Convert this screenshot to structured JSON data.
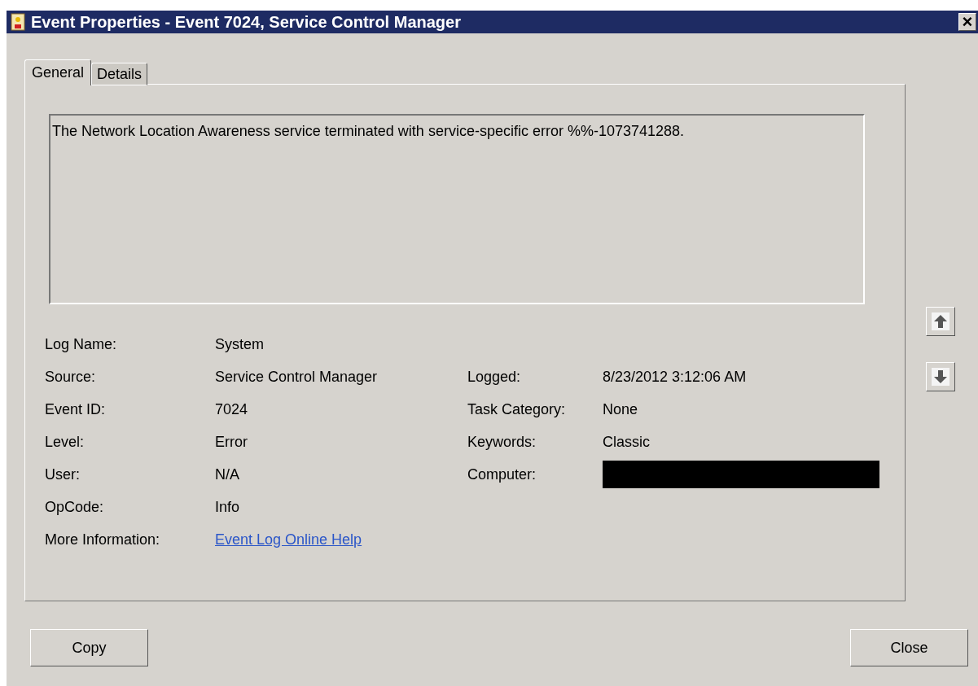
{
  "window": {
    "title": "Event Properties - Event 7024, Service Control Manager",
    "close_glyph": "×"
  },
  "tabs": [
    {
      "label": "General",
      "selected": true
    },
    {
      "label": "Details",
      "selected": false
    }
  ],
  "message": "The Network Location Awareness service terminated with service-specific error %%-1073741288.",
  "rows": [
    {
      "label": "Log Name:",
      "value": "System"
    },
    {
      "label": "Source:",
      "value": "Service Control Manager",
      "right": {
        "label": "Logged:",
        "value": "8/23/2012 3:12:06 AM",
        "kind": "text"
      }
    },
    {
      "label": "Event ID:",
      "value": "7024",
      "right": {
        "label": "Task Category:",
        "value": "None",
        "kind": "text"
      }
    },
    {
      "label": "Level:",
      "value": "Error",
      "right": {
        "label": "Keywords:",
        "value": "Classic",
        "kind": "text"
      }
    },
    {
      "label": "User:",
      "value": "N/A",
      "right": {
        "label": "Computer:",
        "kind": "redacted"
      }
    },
    {
      "label": "OpCode:",
      "value": "Info"
    },
    {
      "label": "More Information:",
      "value": "Event Log Online Help",
      "kind": "link"
    }
  ],
  "buttons": [
    {
      "label": "Copy"
    },
    {
      "label": "Close"
    }
  ]
}
